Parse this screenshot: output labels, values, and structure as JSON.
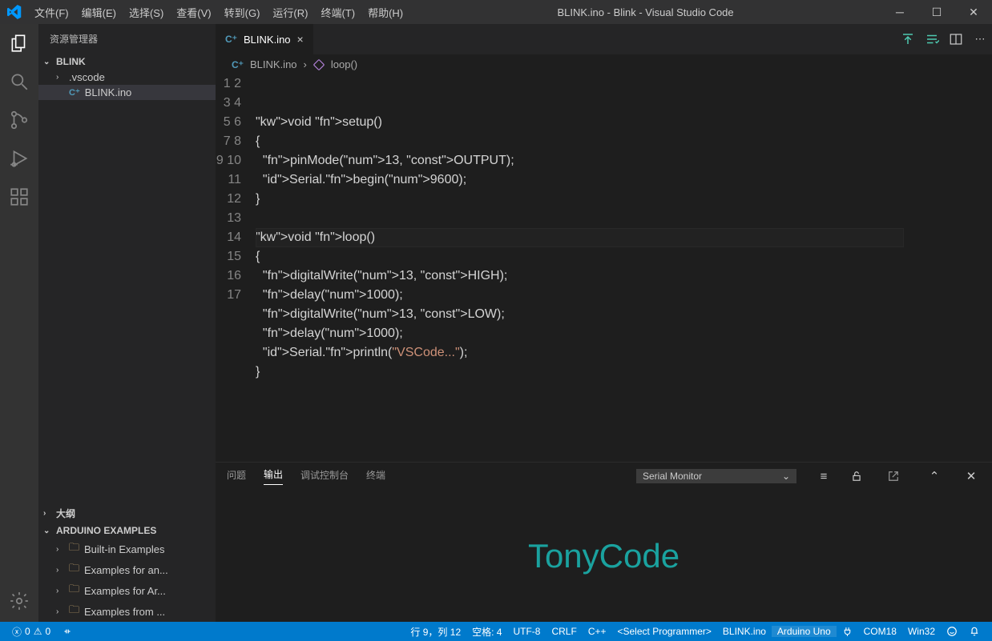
{
  "titlebar": {
    "menus": [
      "文件(F)",
      "编辑(E)",
      "选择(S)",
      "查看(V)",
      "转到(G)",
      "运行(R)",
      "终端(T)",
      "帮助(H)"
    ],
    "title": "BLINK.ino - Blink - Visual Studio Code"
  },
  "sidebar": {
    "header": "资源管理器",
    "project": "BLINK",
    "tree": [
      {
        "label": ".vscode",
        "kind": "folder"
      },
      {
        "label": "BLINK.ino",
        "kind": "cpp",
        "active": true
      }
    ],
    "outline": "大纲",
    "examples_header": "ARDUINO EXAMPLES",
    "examples": [
      "Built-in Examples",
      "Examples for an...",
      "Examples for Ar...",
      "Examples from ..."
    ]
  },
  "tab": {
    "label": "BLINK.ino"
  },
  "breadcrumb": {
    "file": "BLINK.ino",
    "symbol": "loop()"
  },
  "code_lines": [
    "",
    "",
    "void setup()",
    "{",
    "  pinMode(13, OUTPUT);",
    "  Serial.begin(9600);",
    "}",
    "",
    "void loop()",
    "{",
    "  digitalWrite(13, HIGH);",
    "  delay(1000);",
    "  digitalWrite(13, LOW);",
    "  delay(1000);",
    "  Serial.println(\"VSCode...\");",
    "}",
    ""
  ],
  "panel": {
    "tabs": [
      "问题",
      "输出",
      "调试控制台",
      "终端"
    ],
    "active_tab": 1,
    "select": "Serial Monitor",
    "watermark": "TonyCode"
  },
  "statusbar": {
    "errors": "0",
    "warnings": "0",
    "cursor": "行 9，列 12",
    "spaces": "空格: 4",
    "encoding": "UTF-8",
    "eol": "CRLF",
    "lang": "C++",
    "programmer": "<Select Programmer>",
    "sketch": "BLINK.ino",
    "board": "Arduino Uno",
    "port": "COM18",
    "os": "Win32"
  }
}
